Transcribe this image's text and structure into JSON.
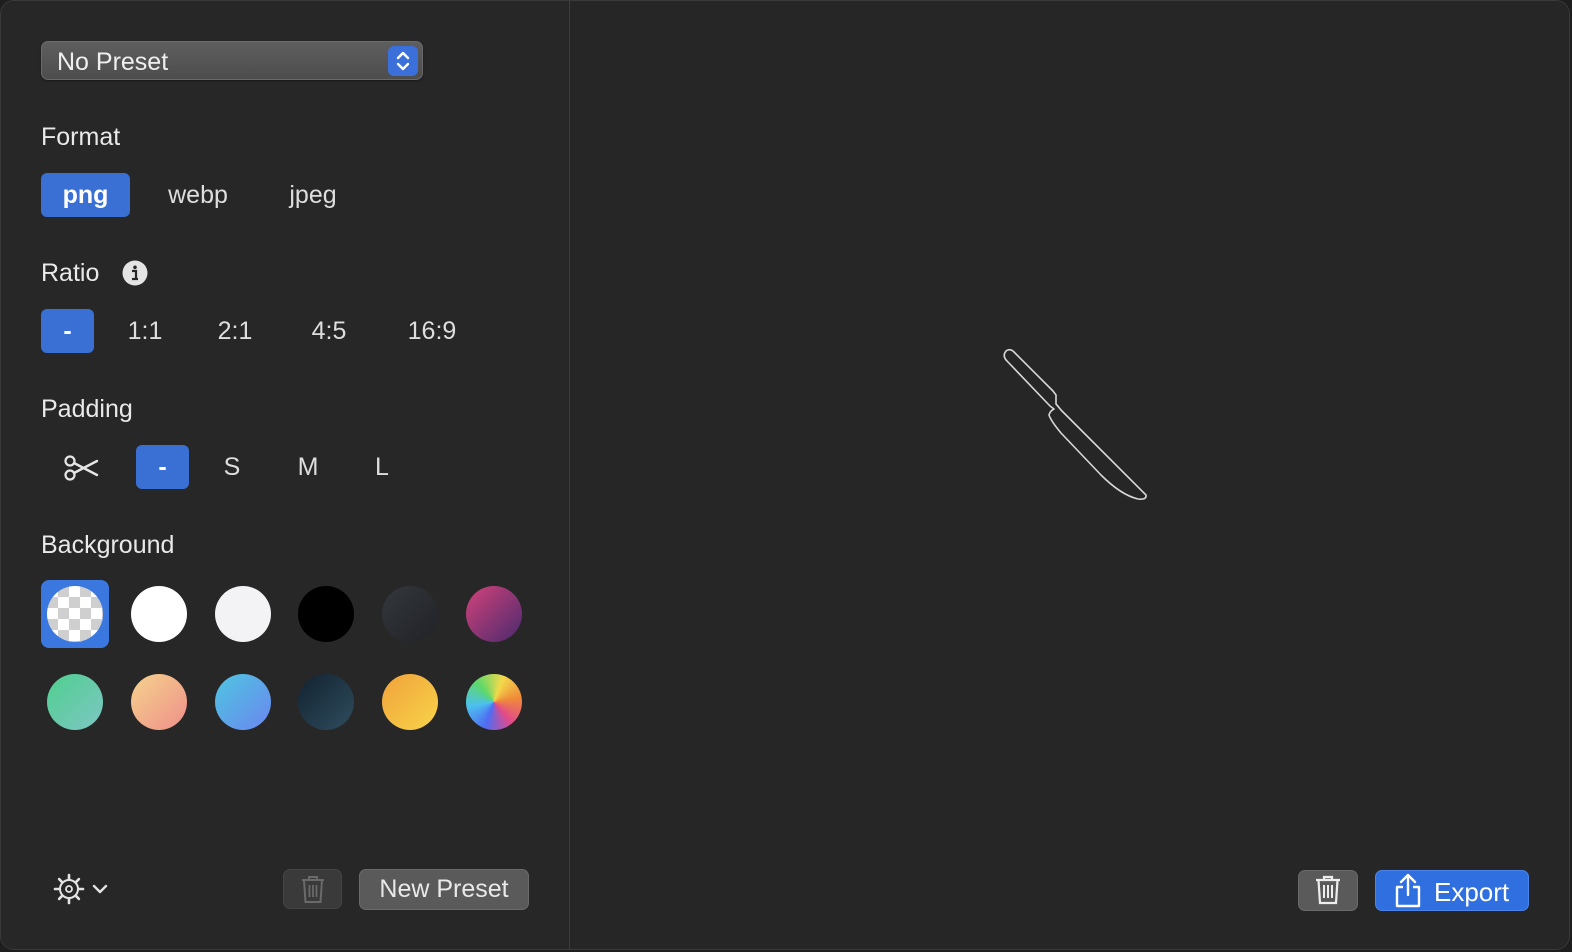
{
  "sidebar": {
    "preset_select": {
      "value": "No Preset"
    },
    "format": {
      "title": "Format",
      "options": [
        "png",
        "webp",
        "jpeg"
      ],
      "selected": "png"
    },
    "ratio": {
      "title": "Ratio",
      "options": [
        "-",
        "1:1",
        "2:1",
        "4:5",
        "16:9"
      ],
      "selected": "-"
    },
    "padding": {
      "title": "Padding",
      "options": [
        "-",
        "S",
        "M",
        "L"
      ],
      "selected": "-"
    },
    "background": {
      "title": "Background",
      "swatches": [
        {
          "name": "transparent",
          "color": "transparent"
        },
        {
          "name": "white",
          "color": "#ffffff"
        },
        {
          "name": "off-white",
          "color": "#f4f4f6"
        },
        {
          "name": "black",
          "color": "#000000"
        },
        {
          "name": "charcoal",
          "color": "#2a2c31"
        },
        {
          "name": "plum-gradient",
          "color": "#c43d7f"
        },
        {
          "name": "mint-gradient",
          "color": "#5fcf9c"
        },
        {
          "name": "peach-gradient",
          "color": "#f2b28a"
        },
        {
          "name": "sky-gradient",
          "color": "#58a8ee"
        },
        {
          "name": "navy-gradient",
          "color": "#22394a"
        },
        {
          "name": "amber-gradient",
          "color": "#f3b63a"
        },
        {
          "name": "rainbow-gradient",
          "color": "#7bd66a"
        }
      ],
      "selected": "transparent"
    },
    "new_preset_label": "New Preset"
  },
  "preview": {
    "export_label": "Export"
  },
  "colors": {
    "accent": "#3a6fd4",
    "panel": "#272727"
  }
}
